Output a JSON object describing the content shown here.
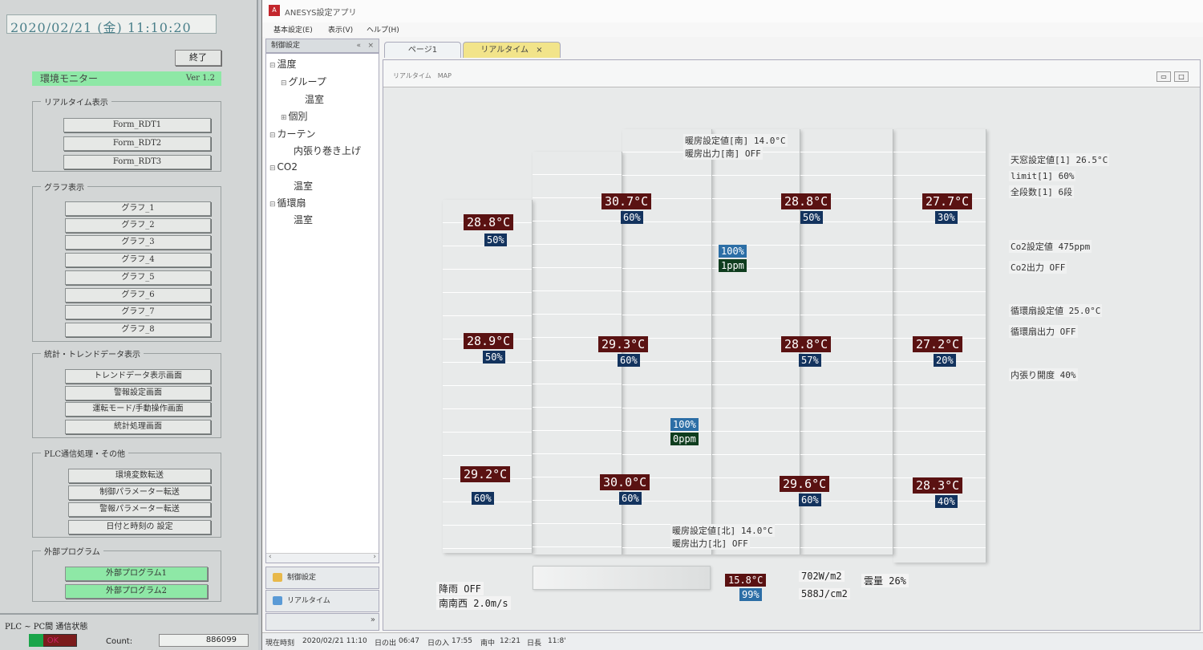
{
  "monitor_app": {
    "datetime": "2020/02/21 (金) 11:10:20",
    "exit_label": "終了",
    "app_title": "環境モニター",
    "version": "Ver 1.2",
    "realtime_group": {
      "title": "リアルタイム表示",
      "buttons": [
        "Form_RDT1",
        "Form_RDT2",
        "Form_RDT3"
      ]
    },
    "graph_group": {
      "title": "グラフ表示",
      "buttons": [
        "グラフ_1",
        "グラフ_2",
        "グラフ_3",
        "グラフ_4",
        "グラフ_5",
        "グラフ_6",
        "グラフ_7",
        "グラフ_8"
      ]
    },
    "stats_group": {
      "title": "統計・トレンドデータ表示",
      "buttons": [
        "トレンドデータ表示画面",
        "警報設定画面",
        "運転モード/手動操作画面",
        "統計処理画面"
      ]
    },
    "plc_group": {
      "title": "PLC通信処理・その他",
      "buttons": [
        "環境変数転送",
        "制御パラメーター転送",
        "警報パラメーター転送",
        "日付と時刻の 設定"
      ]
    },
    "external_group": {
      "title": "外部プログラム",
      "buttons": [
        "外部プログラム1",
        "外部プログラム2"
      ]
    },
    "comm_status": {
      "title": "PLC ~ PC間 通信状態",
      "ok_label": "OK",
      "count_label": "Count:",
      "count_value": "886099"
    }
  },
  "anesys": {
    "window_title": "ANESYS設定アプリ",
    "menu": [
      "基本設定(E)",
      "表示(V)",
      "ヘルプ(H)"
    ],
    "side_panel": {
      "title": "制御設定",
      "tree": [
        {
          "label": "温度",
          "toggle": "⊟",
          "level": 0
        },
        {
          "label": "グループ",
          "toggle": "⊟",
          "level": 1
        },
        {
          "label": "温室",
          "toggle": "",
          "level": 2
        },
        {
          "label": "個別",
          "toggle": "⊞",
          "level": 1
        },
        {
          "label": "カーテン",
          "toggle": "⊟",
          "level": 0
        },
        {
          "label": "内張り巻き上げ",
          "toggle": "",
          "level": 1
        },
        {
          "label": "CO2",
          "toggle": "⊟",
          "level": 0
        },
        {
          "label": "温室",
          "toggle": "",
          "level": 1
        },
        {
          "label": "循環扇",
          "toggle": "⊟",
          "level": 0
        },
        {
          "label": "温室",
          "toggle": "",
          "level": 1
        }
      ],
      "nav_buttons": [
        "制御設定",
        "リアルタイム"
      ]
    },
    "tabs": [
      {
        "label": "ページ1",
        "active": false
      },
      {
        "label": "リアルタイム",
        "active": true
      }
    ],
    "map": {
      "title": "リアルタイム　MAP",
      "heating_south": {
        "setpoint": "暖房設定値[南]  14.0°C",
        "output": "暖房出力[南]  OFF"
      },
      "heating_north": {
        "setpoint": "暖房設定値[北]  14.0°C",
        "output": "暖房出力[北]  OFF"
      },
      "sensors": [
        {
          "temp": "28.8°C",
          "hum": "50%"
        },
        {
          "temp": "30.7°C",
          "hum": "60%"
        },
        {
          "temp": "28.8°C",
          "hum": "50%"
        },
        {
          "temp": "27.7°C",
          "hum": "30%"
        },
        {
          "temp": "28.9°C",
          "hum": "50%"
        },
        {
          "temp": "29.3°C",
          "hum": "60%"
        },
        {
          "temp": "28.8°C",
          "hum": "57%"
        },
        {
          "temp": "27.2°C",
          "hum": "20%"
        },
        {
          "temp": "29.2°C",
          "hum": "60%"
        },
        {
          "temp": "30.0°C",
          "hum": "60%"
        },
        {
          "temp": "29.6°C",
          "hum": "60%"
        },
        {
          "temp": "28.3°C",
          "hum": "40%"
        }
      ],
      "co2_sensors": [
        {
          "pct": "100%",
          "ppm": "1ppm"
        },
        {
          "pct": "100%",
          "ppm": "0ppm"
        }
      ],
      "side_info": {
        "roof_vent_setpoint": "天窓設定値[1]  26.5°C",
        "limit": "limit[1]  60%",
        "total_steps": "全段数[1]  6段",
        "co2_setpoint": "Co2設定値  475ppm",
        "co2_output": "Co2出力  OFF",
        "fan_setpoint": "循環扇設定値  25.0°C",
        "fan_output": "循環扇出力  OFF",
        "curtain_open": "内張り開度  40%"
      },
      "weather": {
        "rain": "降雨  OFF",
        "wind": "南南西  2.0m/s",
        "outdoor_temp": "15.8°C",
        "outdoor_hum": "99%",
        "solar": "702W/m2",
        "solar_total": "588J/cm2",
        "cloud": "雲量  26%"
      }
    },
    "status_bar": {
      "now_label": "現在時刻",
      "now": "2020/02/21 11:10",
      "sunrise_label": "日の出",
      "sunrise": "06:47",
      "sunset_label": "日の入",
      "sunset": "17:55",
      "noon_label": "南中",
      "noon": "12:21",
      "daylength_label": "日長",
      "daylength": "11:8'"
    }
  }
}
